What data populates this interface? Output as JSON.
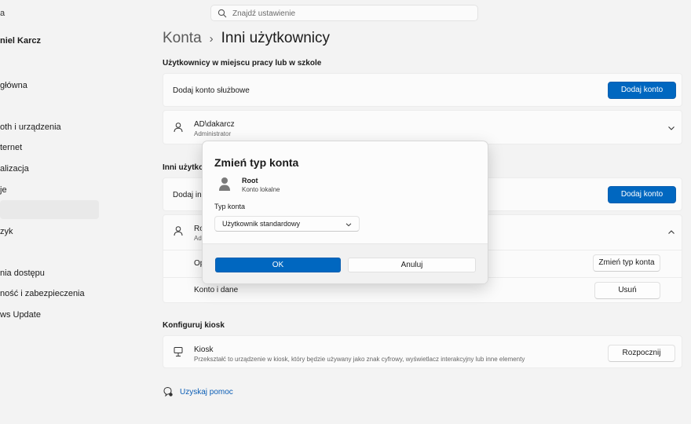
{
  "sidebar": {
    "title": "a",
    "user_name": "niel Karcz",
    "items": [
      {
        "label": "główna"
      },
      {
        "label": "oth i urządzenia"
      },
      {
        "label": "ternet"
      },
      {
        "label": "alizacja"
      },
      {
        "label": "je"
      },
      {
        "label": ""
      },
      {
        "label": "zyk"
      },
      {
        "label": ""
      },
      {
        "label": "nia dostępu"
      },
      {
        "label": "ność i zabezpieczenia"
      },
      {
        "label": "ws Update"
      }
    ]
  },
  "search": {
    "placeholder": "Znajdź ustawienie"
  },
  "header": {
    "parent": "Konta",
    "separator": "›",
    "current": "Inni użytkownicy"
  },
  "work_section": {
    "title": "Użytkownicy w miejscu pracy lub w szkole",
    "add_label": "Dodaj konto służbowe",
    "add_button": "Dodaj konto",
    "account_name": "AD\\dakarcz",
    "account_role": "Administrator"
  },
  "other_section": {
    "title": "Inni użytko",
    "add_label": "Dodaj inn",
    "add_button": "Dodaj konto",
    "user_name": "Ro",
    "user_sub": "Ad",
    "options_label": "Op",
    "change_type_button": "Zmień typ konta",
    "account_data_label": "Konto i dane",
    "remove_button": "Usuń"
  },
  "kiosk_section": {
    "title": "Konfiguruj kiosk",
    "label": "Kiosk",
    "description": "Przekształć to urządzenie w kiosk, który będzie używany jako znak cyfrowy, wyświetlacz interakcyjny lub inne elementy",
    "start_button": "Rozpocznij"
  },
  "help": {
    "label": "Uzyskaj pomoc"
  },
  "dialog": {
    "title": "Zmień typ konta",
    "user_name": "Root",
    "user_kind": "Konto lokalne",
    "type_label": "Typ konta",
    "selected_type": "Użytkownik standardowy",
    "ok_button": "OK",
    "cancel_button": "Anuluj"
  },
  "colors": {
    "accent": "#0067c0",
    "background": "#f3f3f3",
    "card": "#fbfbfb",
    "link": "#0a5db5"
  }
}
